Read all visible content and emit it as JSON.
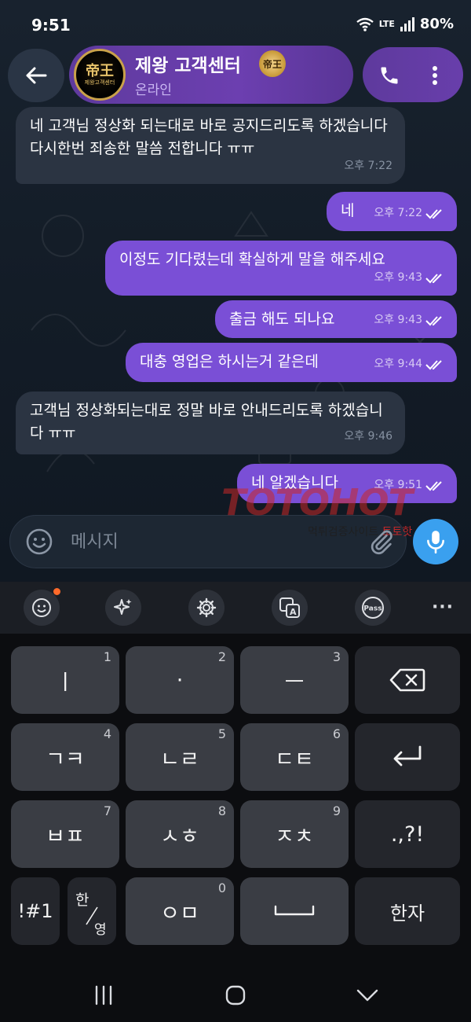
{
  "status_bar": {
    "time": "9:51",
    "network": "LTE",
    "battery": "80%"
  },
  "header": {
    "contact_name": "제왕 고객센터",
    "contact_status": "온라인",
    "avatar_text": "帝王",
    "avatar_subtext": "제왕고객센터",
    "badge_text": "帝王"
  },
  "messages": [
    {
      "direction": "in",
      "text": "네 고객님 정상화 되는대로 바로 공지드리도록 하겠습니다 다시한번 죄송한 말씀 전합니다 ㅠㅠ",
      "time": "오후 7:22"
    },
    {
      "direction": "out",
      "text": "네",
      "time": "오후 7:22"
    },
    {
      "direction": "out",
      "text": "이정도 기다렸는데 확실하게 말을 해주세요",
      "time": "오후 9:43"
    },
    {
      "direction": "out",
      "text": "출금 해도 되나요",
      "time": "오후 9:43"
    },
    {
      "direction": "out",
      "text": "대충 영업은 하시는거 같은데",
      "time": "오후 9:44"
    },
    {
      "direction": "in",
      "text": "고객님 정상화되는대로 정말 바로 안내드리도록 하겠습니다 ㅠㅠ",
      "time": "오후 9:46"
    },
    {
      "direction": "out",
      "text": "네 알겠습니다",
      "time": "오후 9:51"
    }
  ],
  "watermark": {
    "logo": "TOTOHOT",
    "subtitle": "먹튀검증사이트",
    "subtitle_accent": "토토핫"
  },
  "composer": {
    "placeholder": "메시지"
  },
  "keyboard": {
    "rows": [
      [
        {
          "label": "ㅣ",
          "num": "1"
        },
        {
          "label": "·",
          "num": "2"
        },
        {
          "label": "ㅡ",
          "num": "3"
        },
        {
          "label": "backspace",
          "icon": "backspace-icon"
        }
      ],
      [
        {
          "label": "ㄱㅋ",
          "num": "4"
        },
        {
          "label": "ㄴㄹ",
          "num": "5"
        },
        {
          "label": "ㄷㅌ",
          "num": "6"
        },
        {
          "label": "enter",
          "icon": "enter-icon"
        }
      ],
      [
        {
          "label": "ㅂㅍ",
          "num": "7"
        },
        {
          "label": "ㅅㅎ",
          "num": "8"
        },
        {
          "label": "ㅈㅊ",
          "num": "9"
        },
        {
          "label": ".,?!"
        }
      ],
      [
        {
          "label": "!#1"
        },
        {
          "label_top": "한",
          "label_bottom": "영"
        },
        {
          "label": "ㅇㅁ",
          "num": "0"
        },
        {
          "label": "space",
          "icon": "space-icon"
        },
        {
          "label": "한자"
        }
      ]
    ],
    "toolbar": [
      "emoji-icon",
      "sparkle-icon",
      "gear-icon",
      "translate-icon",
      "pass-icon",
      "more-icon"
    ],
    "toolbar_pass_label": "Pass",
    "toolbar_more": "···"
  }
}
